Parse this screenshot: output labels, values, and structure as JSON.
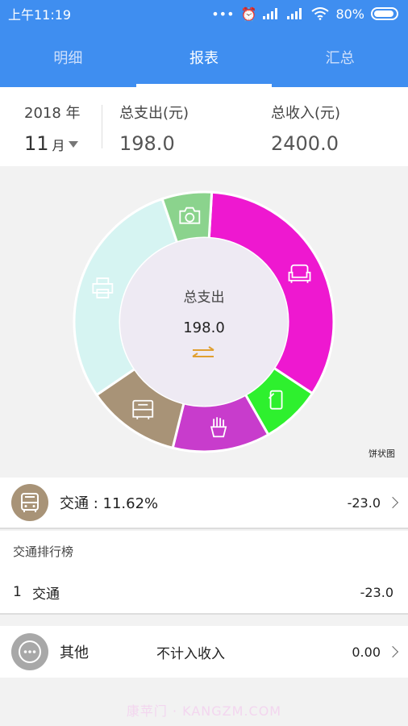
{
  "status": {
    "time": "上午11:19",
    "battery": "80%"
  },
  "tabs": [
    {
      "label": "明细"
    },
    {
      "label": "报表"
    },
    {
      "label": "汇总"
    }
  ],
  "summary": {
    "year": "2018 年",
    "month": "11",
    "month_unit": "月",
    "expense_label": "总支出(元)",
    "expense_value": "198.0",
    "income_label": "总收入(元)",
    "income_value": "2400.0"
  },
  "chart_data": {
    "type": "pie",
    "center_label": "总支出",
    "center_value": "198.0",
    "caption": "饼状图",
    "slices": [
      {
        "category": "家居",
        "fraction": 0.3333,
        "color": "#ee18d0",
        "icon": "sofa-icon"
      },
      {
        "category": "通讯",
        "fraction": 0.0747,
        "color": "#2ef02e",
        "icon": "phone-icon"
      },
      {
        "category": "餐饮",
        "fraction": 0.1212,
        "color": "#c83ccc",
        "icon": "fries-icon"
      },
      {
        "category": "交通",
        "fraction": 0.1162,
        "color": "#a89377",
        "icon": "bus-icon"
      },
      {
        "category": "办公",
        "fraction": 0.2929,
        "color": "#d6f4f2",
        "icon": "printer-icon"
      },
      {
        "category": "摄影",
        "fraction": 0.0617,
        "color": "#8bd38d",
        "icon": "camera-icon"
      }
    ]
  },
  "selected": {
    "label": "交通 : 11.62%",
    "value": "-23.0",
    "icon": "bus-icon"
  },
  "ranking": {
    "title": "交通排行榜",
    "items": [
      {
        "rank": "1",
        "name": "交通",
        "value": "-23.0"
      }
    ]
  },
  "other": {
    "label": "其他",
    "note": "不计入收入",
    "value": "0.00",
    "icon": "more-icon"
  },
  "watermark": "康苹门 · KANGZM.COM"
}
